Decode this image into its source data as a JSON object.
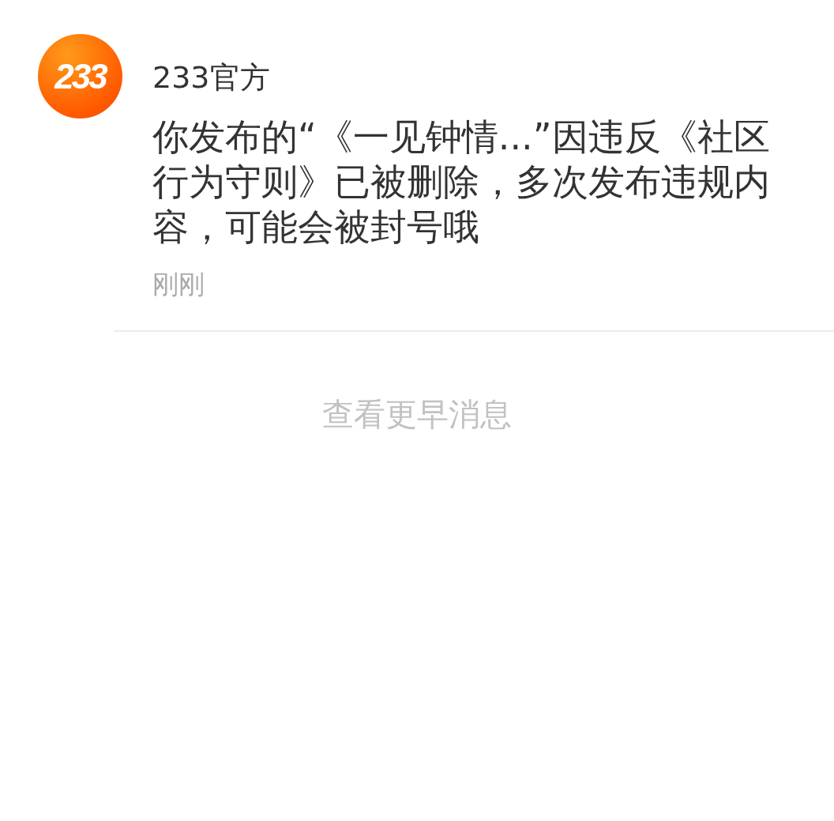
{
  "message": {
    "avatar_text": "233",
    "sender": "233官方",
    "text": "你发布的“《一见钟情...”因违反《社区行为守则》已被删除，多次发布违规内容，可能会被封号哦",
    "time": "刚刚"
  },
  "load_more": "查看更早消息"
}
